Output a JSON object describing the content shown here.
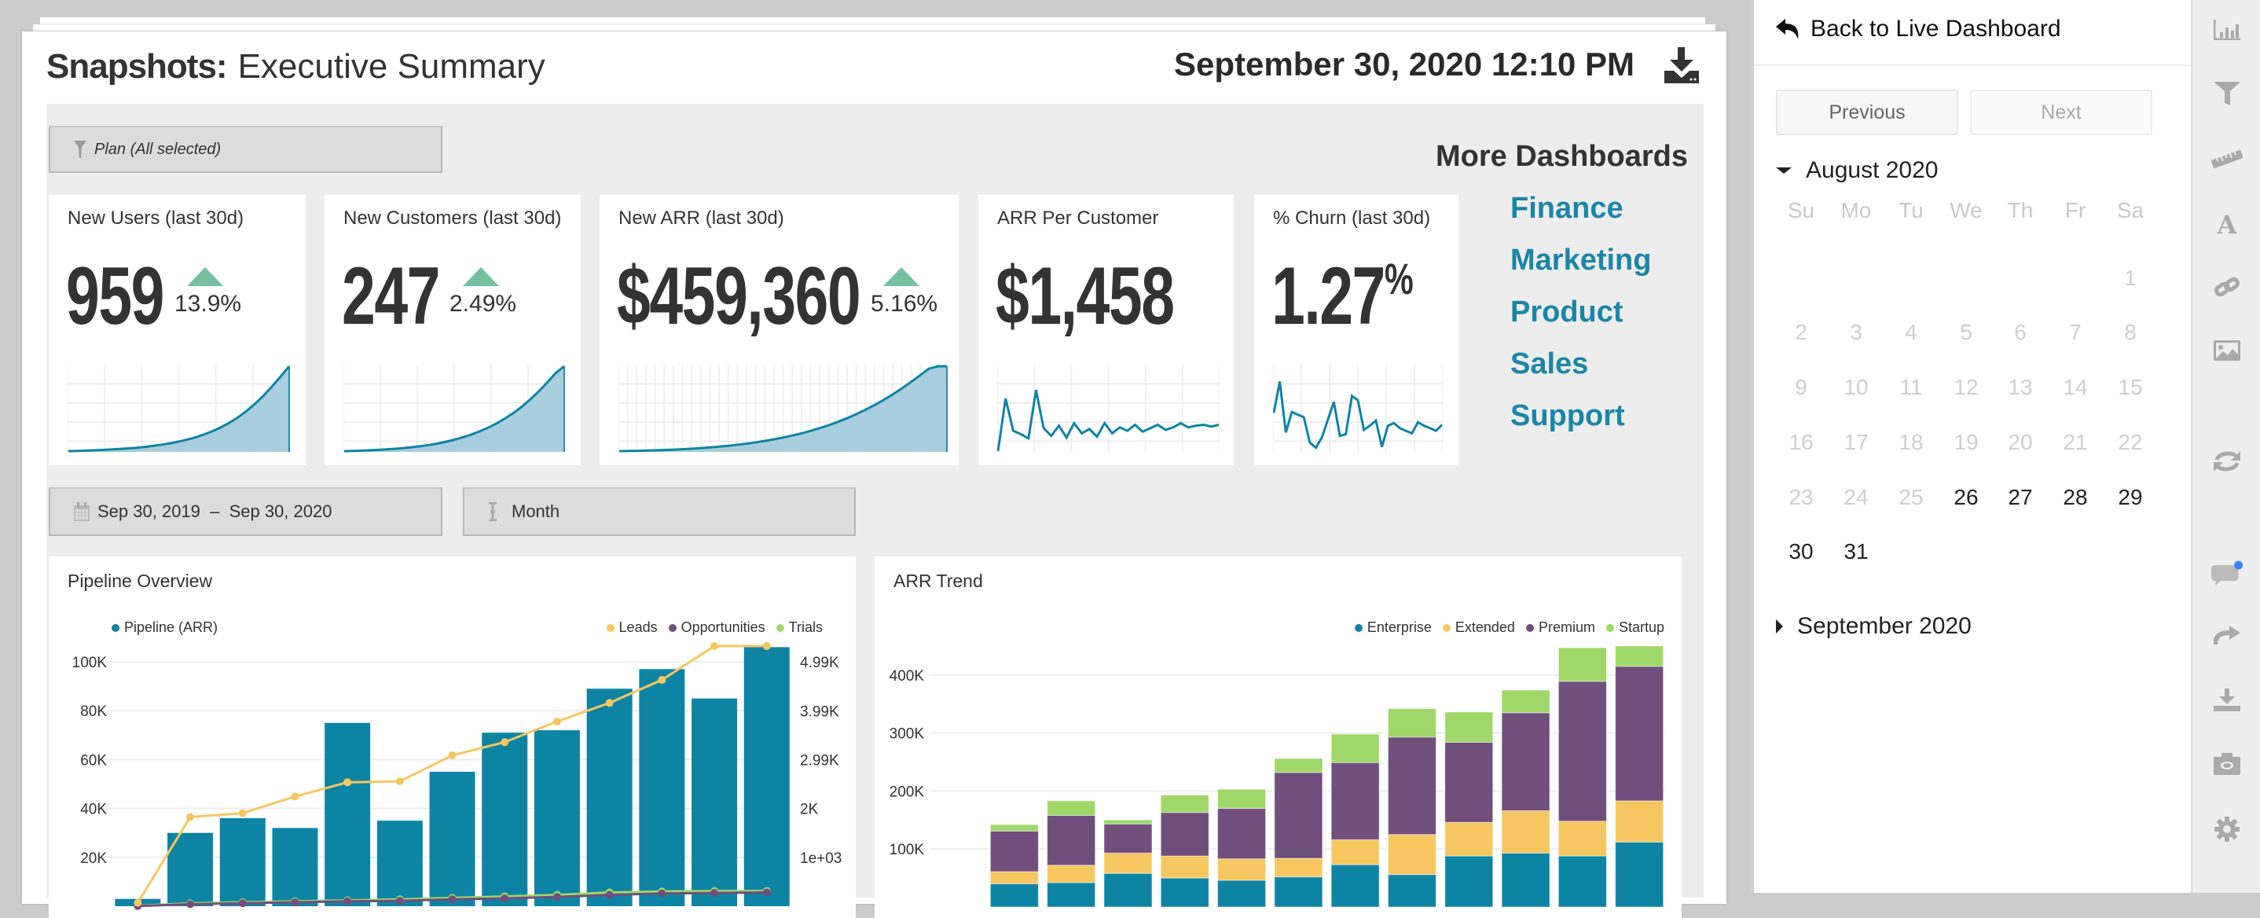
{
  "header": {
    "title_bold": "Snapshots:",
    "title_light": "Executive Summary",
    "snapshot_datetime": "September 30, 2020 12:10 PM",
    "download_icon": "download-icon"
  },
  "filters": {
    "plan": "Plan (All selected)",
    "date_range": "Sep 30, 2019  –  Sep 30, 2020",
    "granularity": "Month"
  },
  "kpis": [
    {
      "title": "New Users (last 30d)",
      "value": "959",
      "change": "13.9%",
      "trend": "up",
      "spark": [
        0,
        0.3,
        0.6,
        1,
        1.4,
        1.9,
        2.5,
        3.2,
        4,
        5,
        6.2,
        7.6,
        9.3,
        11.3,
        13.6,
        16.4,
        19.7,
        23.6,
        28.2,
        33.6,
        40,
        47.5,
        56,
        65.6,
        76.5,
        88,
        100
      ]
    },
    {
      "title": "New Customers (last 30d)",
      "value": "247",
      "change": "2.49%",
      "trend": "up",
      "spark": [
        0,
        0.3,
        0.6,
        1,
        1.5,
        2.1,
        2.8,
        3.6,
        4.6,
        5.8,
        7.2,
        8.9,
        11,
        13.4,
        16.2,
        19.4,
        23.2,
        27.6,
        32.6,
        38.4,
        45,
        52.5,
        61,
        70.5,
        81,
        92,
        100
      ]
    },
    {
      "title": "New ARR (last 30d)",
      "value": "$459,360",
      "change": "5.16%",
      "trend": "up",
      "spark": [
        0,
        0.2,
        0.4,
        0.7,
        1,
        1.4,
        1.8,
        2.3,
        2.9,
        3.6,
        4.4,
        5.3,
        6.3,
        7.5,
        8.8,
        10.3,
        12,
        13.9,
        16,
        18.3,
        20.9,
        23.8,
        27,
        30.5,
        34.4,
        38.7,
        43.4,
        48.5,
        54,
        60,
        66.5,
        73.5,
        81,
        89,
        97,
        100,
        100
      ]
    },
    {
      "title": "ARR Per Customer",
      "value": "$1,458",
      "spark": [
        0,
        62,
        24,
        20,
        15,
        72,
        27,
        18,
        30,
        16,
        33,
        21,
        26,
        17,
        33,
        21,
        28,
        24,
        31,
        23,
        27,
        31,
        25,
        28,
        33,
        28,
        30,
        31,
        29,
        31
      ]
    },
    {
      "title": "% Churn (last 30d)",
      "value": "1.27",
      "value_suffix": "%",
      "spark": [
        45,
        82,
        22,
        46,
        43,
        40,
        10,
        4,
        16,
        37,
        58,
        18,
        20,
        65,
        60,
        25,
        30,
        36,
        5,
        30,
        33,
        27,
        24,
        21,
        34,
        30,
        27,
        24,
        31
      ]
    }
  ],
  "more_dashboards": {
    "title": "More Dashboards",
    "links": [
      "Finance",
      "Marketing",
      "Product",
      "Sales",
      "Support"
    ]
  },
  "colors": {
    "teal": "#0e84a5",
    "yellow": "#f6c760",
    "purple": "#714f7c",
    "green": "#9fd869",
    "up_arrow": "#74c0a1",
    "link": "#1a86a7"
  },
  "chart_data": [
    {
      "type": "bar",
      "title": "Pipeline Overview",
      "grid": true,
      "legend_left": [
        "Pipeline (ARR)"
      ],
      "legend_right": [
        "Leads",
        "Opportunities",
        "Trials"
      ],
      "y_ticks": [
        "100K",
        "80K",
        "60K",
        "40K",
        "20K"
      ],
      "y_tick_values": [
        100000,
        80000,
        60000,
        40000,
        20000
      ],
      "y2_ticks": [
        "4.99K",
        "3.99K",
        "2.99K",
        "2K",
        "1e+03"
      ],
      "y2_tick_values": [
        4990,
        3990,
        2990,
        1996,
        998
      ],
      "ylim": [
        0,
        100000
      ],
      "y2lim": [
        0,
        4990
      ],
      "series": [
        {
          "name": "Pipeline (ARR)",
          "kind": "bar",
          "axis": "left",
          "color": "#0e84a5",
          "values": [
            3000,
            30000,
            36000,
            32000,
            75000,
            35000,
            55000,
            71000,
            72000,
            89000,
            97000,
            85000,
            106000
          ]
        },
        {
          "name": "Leads",
          "kind": "line",
          "axis": "right",
          "color": "#f6c760",
          "values": [
            70,
            1820,
            1900,
            2240,
            2530,
            2550,
            3080,
            3350,
            3770,
            4150,
            4620,
            5310,
            5310
          ]
        },
        {
          "name": "Opportunities",
          "kind": "line",
          "axis": "right",
          "color": "#714f7c",
          "values": [
            5,
            40,
            60,
            80,
            100,
            110,
            140,
            160,
            190,
            230,
            260,
            270,
            280
          ]
        },
        {
          "name": "Trials",
          "kind": "line",
          "axis": "right",
          "color": "#9fd869",
          "values": [
            10,
            60,
            80,
            100,
            120,
            140,
            170,
            200,
            230,
            280,
            300,
            310,
            310
          ]
        }
      ]
    },
    {
      "type": "bar",
      "stacked": true,
      "title": "ARR Trend",
      "grid": true,
      "legend": [
        "Enterprise",
        "Extended",
        "Premium",
        "Startup"
      ],
      "y_ticks": [
        "400K",
        "300K",
        "200K",
        "100K"
      ],
      "y_tick_values": [
        400000,
        300000,
        200000,
        100000
      ],
      "ylim": [
        0,
        450000
      ],
      "series": [
        {
          "name": "Enterprise",
          "color": "#0e84a5",
          "values": [
            0,
            40000,
            42000,
            58000,
            50000,
            46000,
            52000,
            73000,
            56000,
            88000,
            93000,
            88000,
            112000
          ]
        },
        {
          "name": "Extended",
          "color": "#f6c760",
          "values": [
            0,
            21000,
            30000,
            35000,
            38000,
            37000,
            32000,
            43000,
            69000,
            58000,
            73000,
            60000,
            71000
          ]
        },
        {
          "name": "Premium",
          "color": "#714f7c",
          "values": [
            0,
            70000,
            86000,
            50000,
            75000,
            87000,
            148000,
            133000,
            168000,
            138000,
            169000,
            241000,
            232000
          ]
        },
        {
          "name": "Startup",
          "color": "#9fd869",
          "values": [
            0,
            11000,
            25000,
            7000,
            30000,
            33000,
            24000,
            49000,
            49000,
            52000,
            39000,
            58000,
            35000
          ]
        }
      ]
    }
  ],
  "right_panel": {
    "back_label": "Back to Live Dashboard",
    "previous_label": "Previous",
    "next_label": "Next",
    "next_disabled": true,
    "calendar": {
      "expanded_month": "August 2020",
      "weekdays": [
        "Su",
        "Mo",
        "Tu",
        "We",
        "Th",
        "Fr",
        "Sa"
      ],
      "first_weekday_index": 6,
      "days_in_month": 31,
      "available_days": [
        26,
        27,
        28,
        29,
        30,
        31
      ],
      "collapsed_month": "September 2020"
    }
  },
  "icon_bar": {
    "items": [
      "bar-chart-icon",
      "filter-icon",
      "ruler-icon",
      "text-icon",
      "link-icon",
      "image-icon",
      "refresh-icon",
      "comment-icon",
      "share-icon",
      "download-icon",
      "camera-icon",
      "gear-icon"
    ],
    "comment_badge_color": "#3b82f6"
  }
}
